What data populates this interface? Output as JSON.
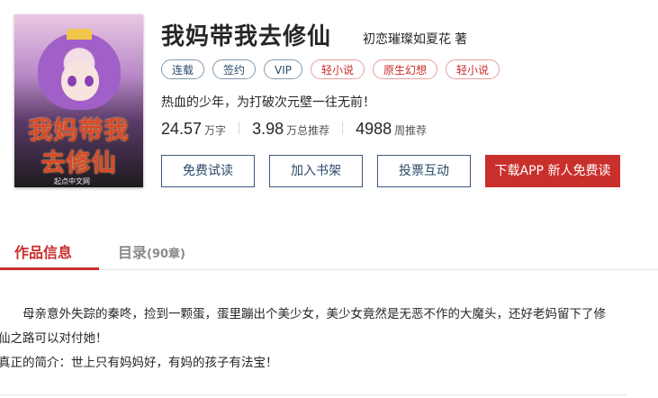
{
  "book": {
    "title": "我妈带我去修仙",
    "author": "初恋璀璨如夏花",
    "author_suffix": "著",
    "cover_art_text_line1": "我妈带我",
    "cover_art_text_line2": "去修仙",
    "publisher_mark": "起点中文网",
    "tags": [
      {
        "label": "连载",
        "style": "blue"
      },
      {
        "label": "签约",
        "style": "blue"
      },
      {
        "label": "VIP",
        "style": "blue"
      },
      {
        "label": "轻小说",
        "style": "red"
      },
      {
        "label": "原生幻想",
        "style": "red"
      },
      {
        "label": "轻小说",
        "style": "red"
      }
    ],
    "tagline": "热血的少年，为打破次元壁一往无前！",
    "stats": [
      {
        "value": "24.57",
        "unit": "万字"
      },
      {
        "value": "3.98",
        "unit": "万总推荐"
      },
      {
        "value": "4988",
        "unit": "周推荐"
      }
    ]
  },
  "actions": {
    "read_free": "免费试读",
    "add_shelf": "加入书架",
    "vote": "投票互动",
    "download": "下载APP 新人免费读"
  },
  "tabs": {
    "info": "作品信息",
    "toc": "目录",
    "toc_count": "(90章)"
  },
  "description": {
    "paragraph1": "母亲意外失踪的秦咚，捡到一颗蛋，蛋里蹦出个美少女，美少女竟然是无恶不作的大魔头，还好老妈留下了修",
    "paragraph1_cont": "仙之路可以对付她！",
    "paragraph2": "真正的简介：世上只有妈妈好，有妈的孩子有法宝！"
  },
  "colors": {
    "accent_red": "#c92e2e",
    "button_blue": "#3f5a7d"
  }
}
